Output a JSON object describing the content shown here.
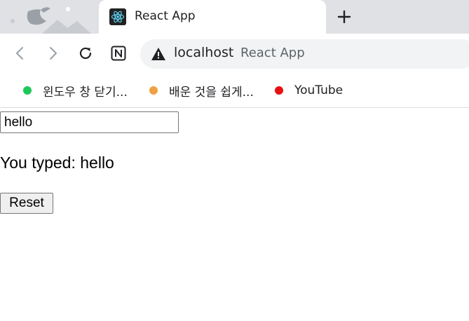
{
  "browser": {
    "tab": {
      "title": "React App",
      "favicon_icon": "react-logo-icon"
    },
    "new_tab_icon": "plus-icon",
    "toolbar": {
      "back_icon": "chevron-left-icon",
      "forward_icon": "chevron-right-icon",
      "reload_icon": "reload-icon",
      "extension_icon": "notion-icon",
      "omnibox": {
        "security_icon": "warning-icon",
        "host": "localhost",
        "page_title": "React App"
      }
    },
    "bookmarks": [
      {
        "label": "윈도우 창 닫기...",
        "color": "#1ec85a"
      },
      {
        "label": "배운 것을 쉽게...",
        "color": "#f0a142"
      },
      {
        "label": "YouTube",
        "color": "#e81010"
      }
    ]
  },
  "page": {
    "input_value": "hello",
    "typed_text": "You typed: hello",
    "reset_label": "Reset"
  }
}
